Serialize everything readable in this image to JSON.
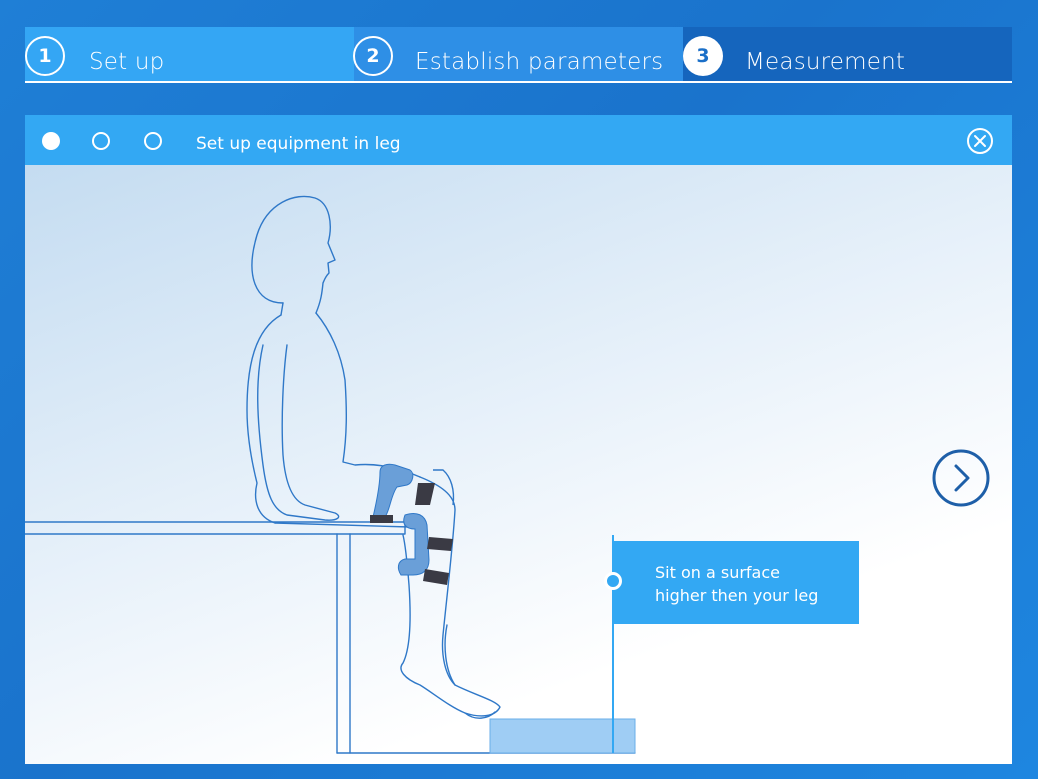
{
  "steps": [
    {
      "number": "1",
      "label": "Set up"
    },
    {
      "number": "2",
      "label": "Establish parameters"
    },
    {
      "number": "3",
      "label": "Measurement"
    }
  ],
  "active_step": 3,
  "panel": {
    "title": "Set up equipment in leg",
    "progress_dots": [
      true,
      false,
      false
    ],
    "close_icon": "close-circle-icon",
    "next_icon": "chevron-right-circle-icon"
  },
  "callout": {
    "line1": "Sit on a surface",
    "line2": "higher then your leg"
  },
  "colors": {
    "background": "#1a73cc",
    "tab_light": "#34a6f4",
    "tab_mid": "#2e8fe6",
    "tab_dark": "#1565bd",
    "panel_header": "#33a8f3",
    "illustration_stroke": "#2f78c8",
    "brace": "#6a9fd8",
    "strap": "#3a3a44"
  }
}
